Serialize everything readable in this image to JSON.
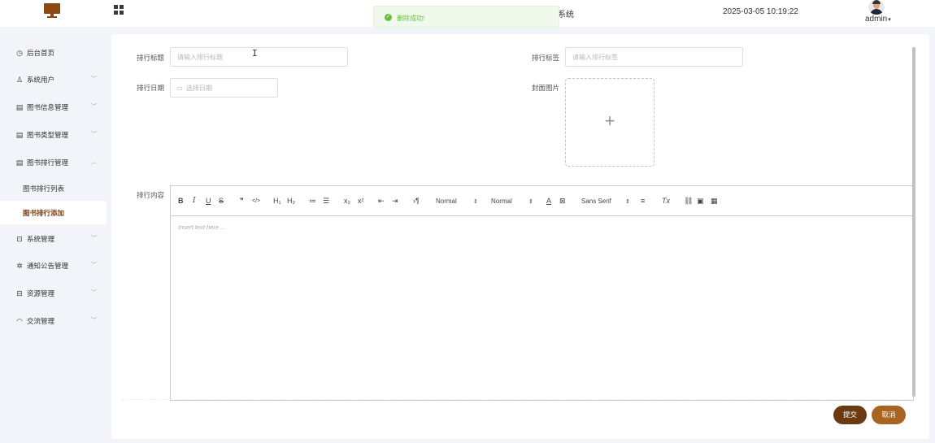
{
  "header": {
    "title_partial": "系统",
    "datetime": "2025-03-05 10:19:22",
    "user": "admin",
    "user_caret": "▾"
  },
  "toast": {
    "message": "删除成功!",
    "icon": "check-circle-icon",
    "icon_glyph": "✓",
    "color": "#67c23a"
  },
  "sidebar": {
    "items": [
      {
        "icon": "clock-icon",
        "glyph": "◷",
        "label": "后台首页",
        "chevron": ""
      },
      {
        "icon": "user-icon",
        "glyph": "♙",
        "label": "系统用户",
        "chevron": "﹀"
      },
      {
        "icon": "book-icon",
        "glyph": "▤",
        "label": "图书信息管理",
        "chevron": "﹀"
      },
      {
        "icon": "book-icon",
        "glyph": "▤",
        "label": "图书类型管理",
        "chevron": "﹀"
      },
      {
        "icon": "list-icon",
        "glyph": "▤",
        "label": "图书排行管理",
        "chevron": "︿"
      },
      {
        "icon": "settings-icon",
        "glyph": "⊡",
        "label": "系统管理",
        "chevron": "﹀"
      },
      {
        "icon": "bell-icon",
        "glyph": "✲",
        "label": "通知公告管理",
        "chevron": "﹀"
      },
      {
        "icon": "box-icon",
        "glyph": "⊟",
        "label": "资源管理",
        "chevron": "﹀"
      },
      {
        "icon": "headset-icon",
        "glyph": "◠",
        "label": "交流管理",
        "chevron": "﹀"
      }
    ],
    "sub_items": [
      {
        "label": "图书排行列表",
        "active": false
      },
      {
        "label": "图书排行添加",
        "active": true
      }
    ],
    "active_color": "#7a3e0b"
  },
  "form": {
    "title_label": "排行标题",
    "title_placeholder": "请输入排行标题",
    "tag_label": "排行标签",
    "tag_placeholder": "请输入排行标签",
    "date_label": "排行日期",
    "date_placeholder": "选择日期",
    "cover_label": "封面图片",
    "content_label": "排行内容",
    "upload_plus": "+"
  },
  "editor": {
    "placeholder": "Insert text here ...",
    "header_select": "Normal",
    "size_select": "Normal",
    "font_select": "Sans Serif",
    "tools": {
      "bold": "B",
      "italic": "I",
      "underline": "U",
      "strike": "S",
      "quote": "❞",
      "code": "</>",
      "h1": "H₁",
      "h2": "H₂",
      "ol": "≔",
      "ul": "☰",
      "sub": "x₂",
      "sup": "x²",
      "outdent": "⇤",
      "indent": "⇥",
      "direction": "›¶",
      "color": "A",
      "background": "⊠",
      "align": "≡",
      "clean": "Tx",
      "link": "⛓",
      "image": "▣",
      "video": "▦",
      "arrows": "⇕"
    }
  },
  "buttons": {
    "submit": "提交",
    "cancel": "取消",
    "submit_color": "#6b3a10",
    "cancel_color": "#a86521"
  }
}
